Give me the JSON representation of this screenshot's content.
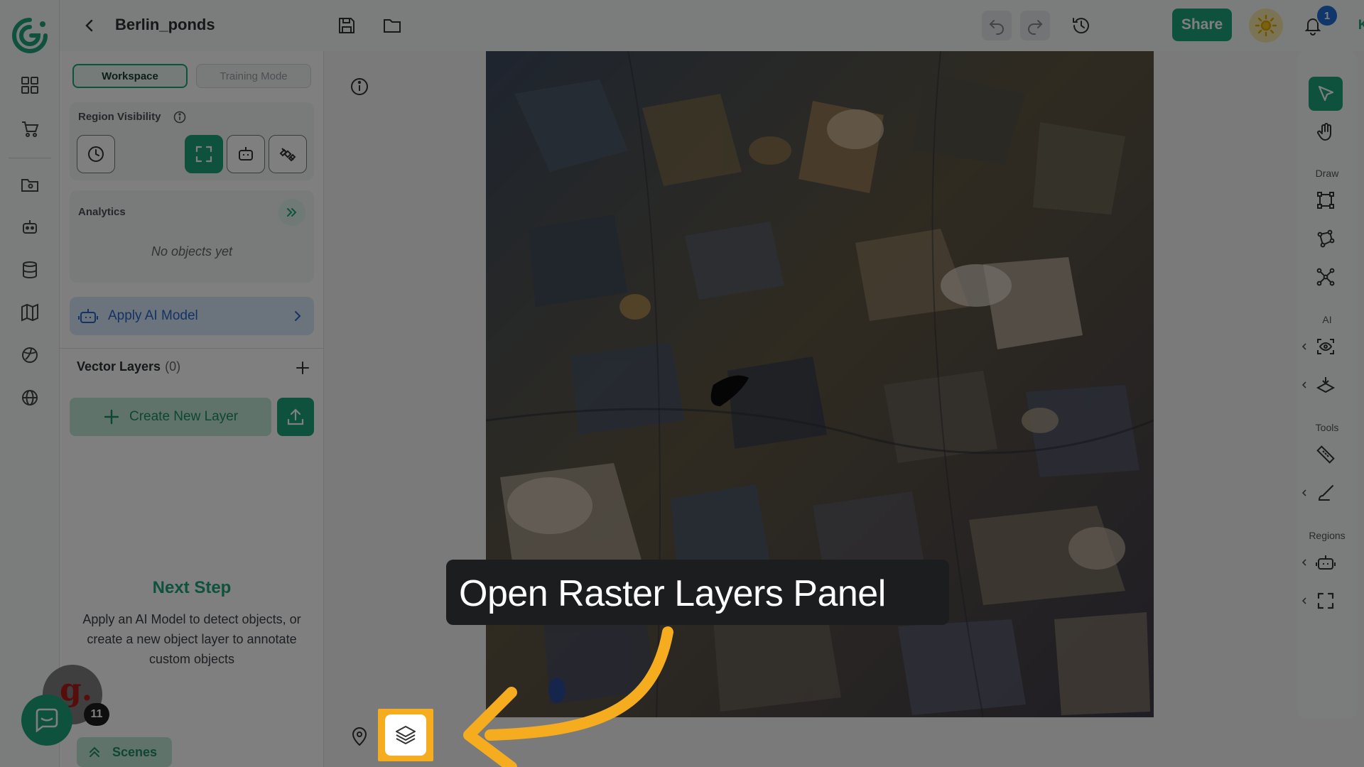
{
  "app": {
    "project_title": "Berlin_ponds",
    "share_label": "Share",
    "notifications_count": "1",
    "user_initials": "KG"
  },
  "panel": {
    "tabs": [
      {
        "label": "Workspace",
        "active": true
      },
      {
        "label": "Training Mode",
        "active": false
      }
    ],
    "region_visibility_label": "Region Visibility",
    "analytics_label": "Analytics",
    "analytics_empty": "No objects yet",
    "apply_model_label": "Apply AI Model",
    "vector_layers_label": "Vector Layers",
    "vector_layers_count": "(0)",
    "create_layer_label": "Create New Layer",
    "next_step_title": "Next Step",
    "next_step_desc": "Apply an AI Model to detect objects, or create a new object layer to annotate custom objects",
    "scenes_label": "Scenes"
  },
  "right_toolbar": {
    "sections": [
      "Draw",
      "AI",
      "Tools",
      "Regions"
    ]
  },
  "guide": {
    "tooltip": "Open Raster Layers Panel",
    "highlight_color": "#f5ac1e"
  },
  "chat": {
    "unread_count": "11"
  },
  "colors": {
    "accent": "#1da47a",
    "badge_blue": "#1f6fd6"
  }
}
